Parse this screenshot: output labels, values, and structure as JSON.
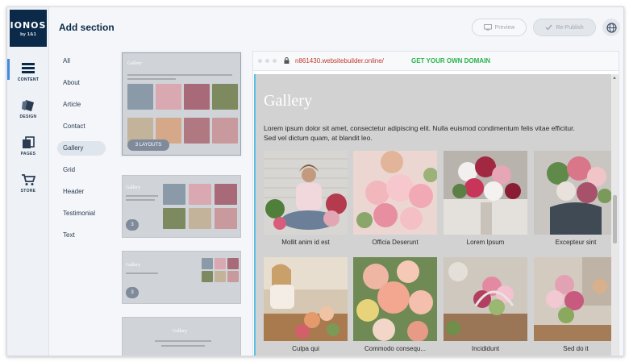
{
  "app": {
    "logo": "IONOS",
    "logo_sub": "by 1&1",
    "section_title": "Add section"
  },
  "rail": [
    {
      "label": "CONTENT",
      "icon": "content-icon",
      "active": true
    },
    {
      "label": "DESIGN",
      "icon": "design-icon",
      "active": false
    },
    {
      "label": "PAGES",
      "icon": "pages-icon",
      "active": false
    },
    {
      "label": "STORE",
      "icon": "store-icon",
      "active": false
    }
  ],
  "toolbar": {
    "preview_label": "Preview",
    "republish_label": "Re-Publish",
    "globe_icon": "globe-icon"
  },
  "categories": [
    "All",
    "About",
    "Article",
    "Contact",
    "Gallery",
    "Grid",
    "Header",
    "Testimonial",
    "Text"
  ],
  "selected_category": "Gallery",
  "layouts": [
    {
      "title": "Gallery",
      "badge": "3 LAYOUTS"
    },
    {
      "title": "Gallery",
      "badge": "3"
    },
    {
      "title": "Gallery",
      "badge": "3"
    },
    {
      "title": "Gallery",
      "badge": ""
    }
  ],
  "browser": {
    "url": "n861430.websitebuilder.online/",
    "promo": "GET YOUR OWN DOMAIN"
  },
  "gallery": {
    "title": "Gallery",
    "text_line1": "Lorem ipsum dolor sit amet, consectetur adipiscing elit. Nulla euismod condimentum felis vitae efficitur.",
    "text_line2": "Sed vel dictum quam, at blandit leo.",
    "items": [
      {
        "caption": "Mollit anim id est"
      },
      {
        "caption": "Officia Deserunt"
      },
      {
        "caption": "Lorem Ipsum"
      },
      {
        "caption": "Excepteur sint"
      },
      {
        "caption": "Culpa qui"
      },
      {
        "caption": "Commodo consequ..."
      },
      {
        "caption": "Incididunt"
      },
      {
        "caption": "Sed do it"
      }
    ]
  },
  "colors": {
    "brand": "#0b2a4a",
    "accent": "#3f8be0",
    "url_red": "#c0392b",
    "promo_green": "#28b34b",
    "site_bg": "#d2d2d2"
  }
}
